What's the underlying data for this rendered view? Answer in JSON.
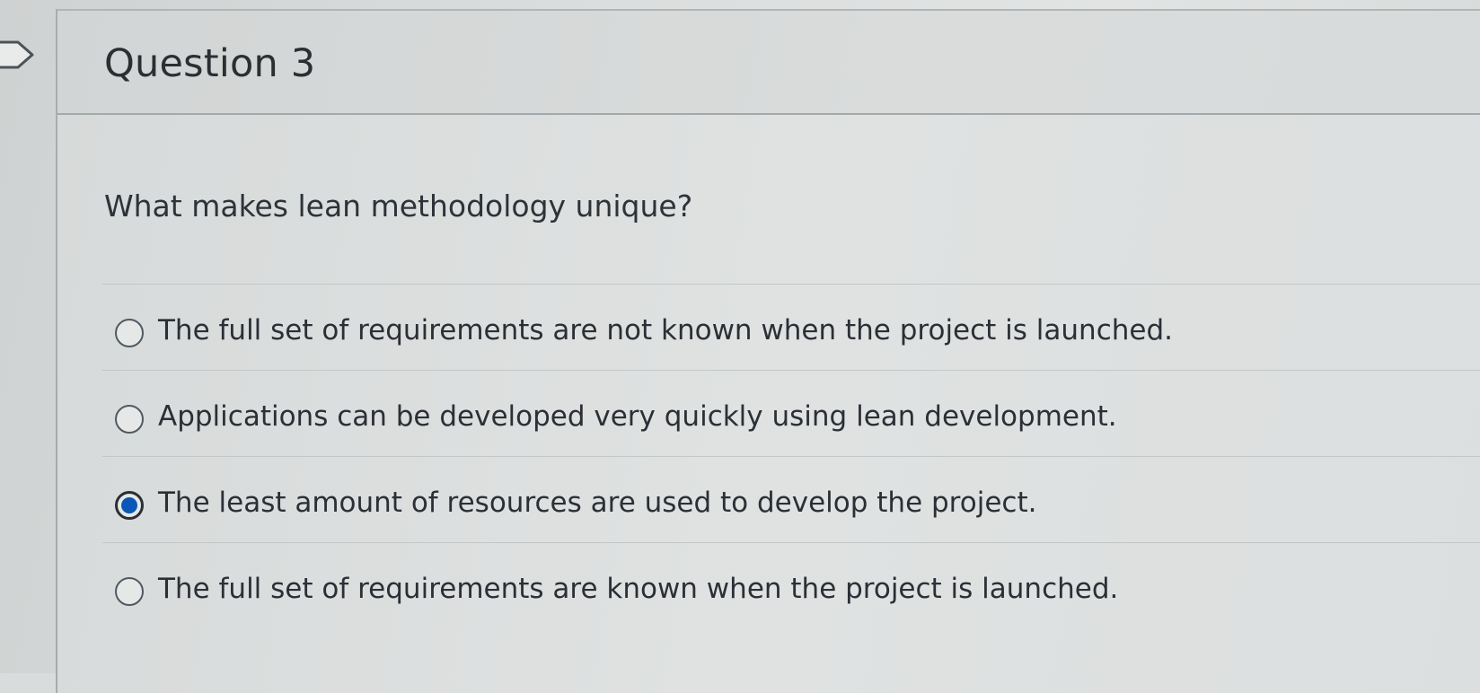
{
  "question": {
    "title": "Question 3",
    "text": "What makes lean methodology unique?"
  },
  "answers": [
    {
      "label": "The full set of requirements are not known when the project is launched.",
      "selected": false
    },
    {
      "label": "Applications can be developed very quickly using lean development.",
      "selected": false
    },
    {
      "label": "The least amount of resources are used to develop the project.",
      "selected": true
    },
    {
      "label": "The full set of requirements are known when the project is launched.",
      "selected": false
    }
  ],
  "icons": {
    "flag": "flag-icon"
  },
  "colors": {
    "selected_radio": "#0b57b8",
    "text": "#2b3036"
  }
}
